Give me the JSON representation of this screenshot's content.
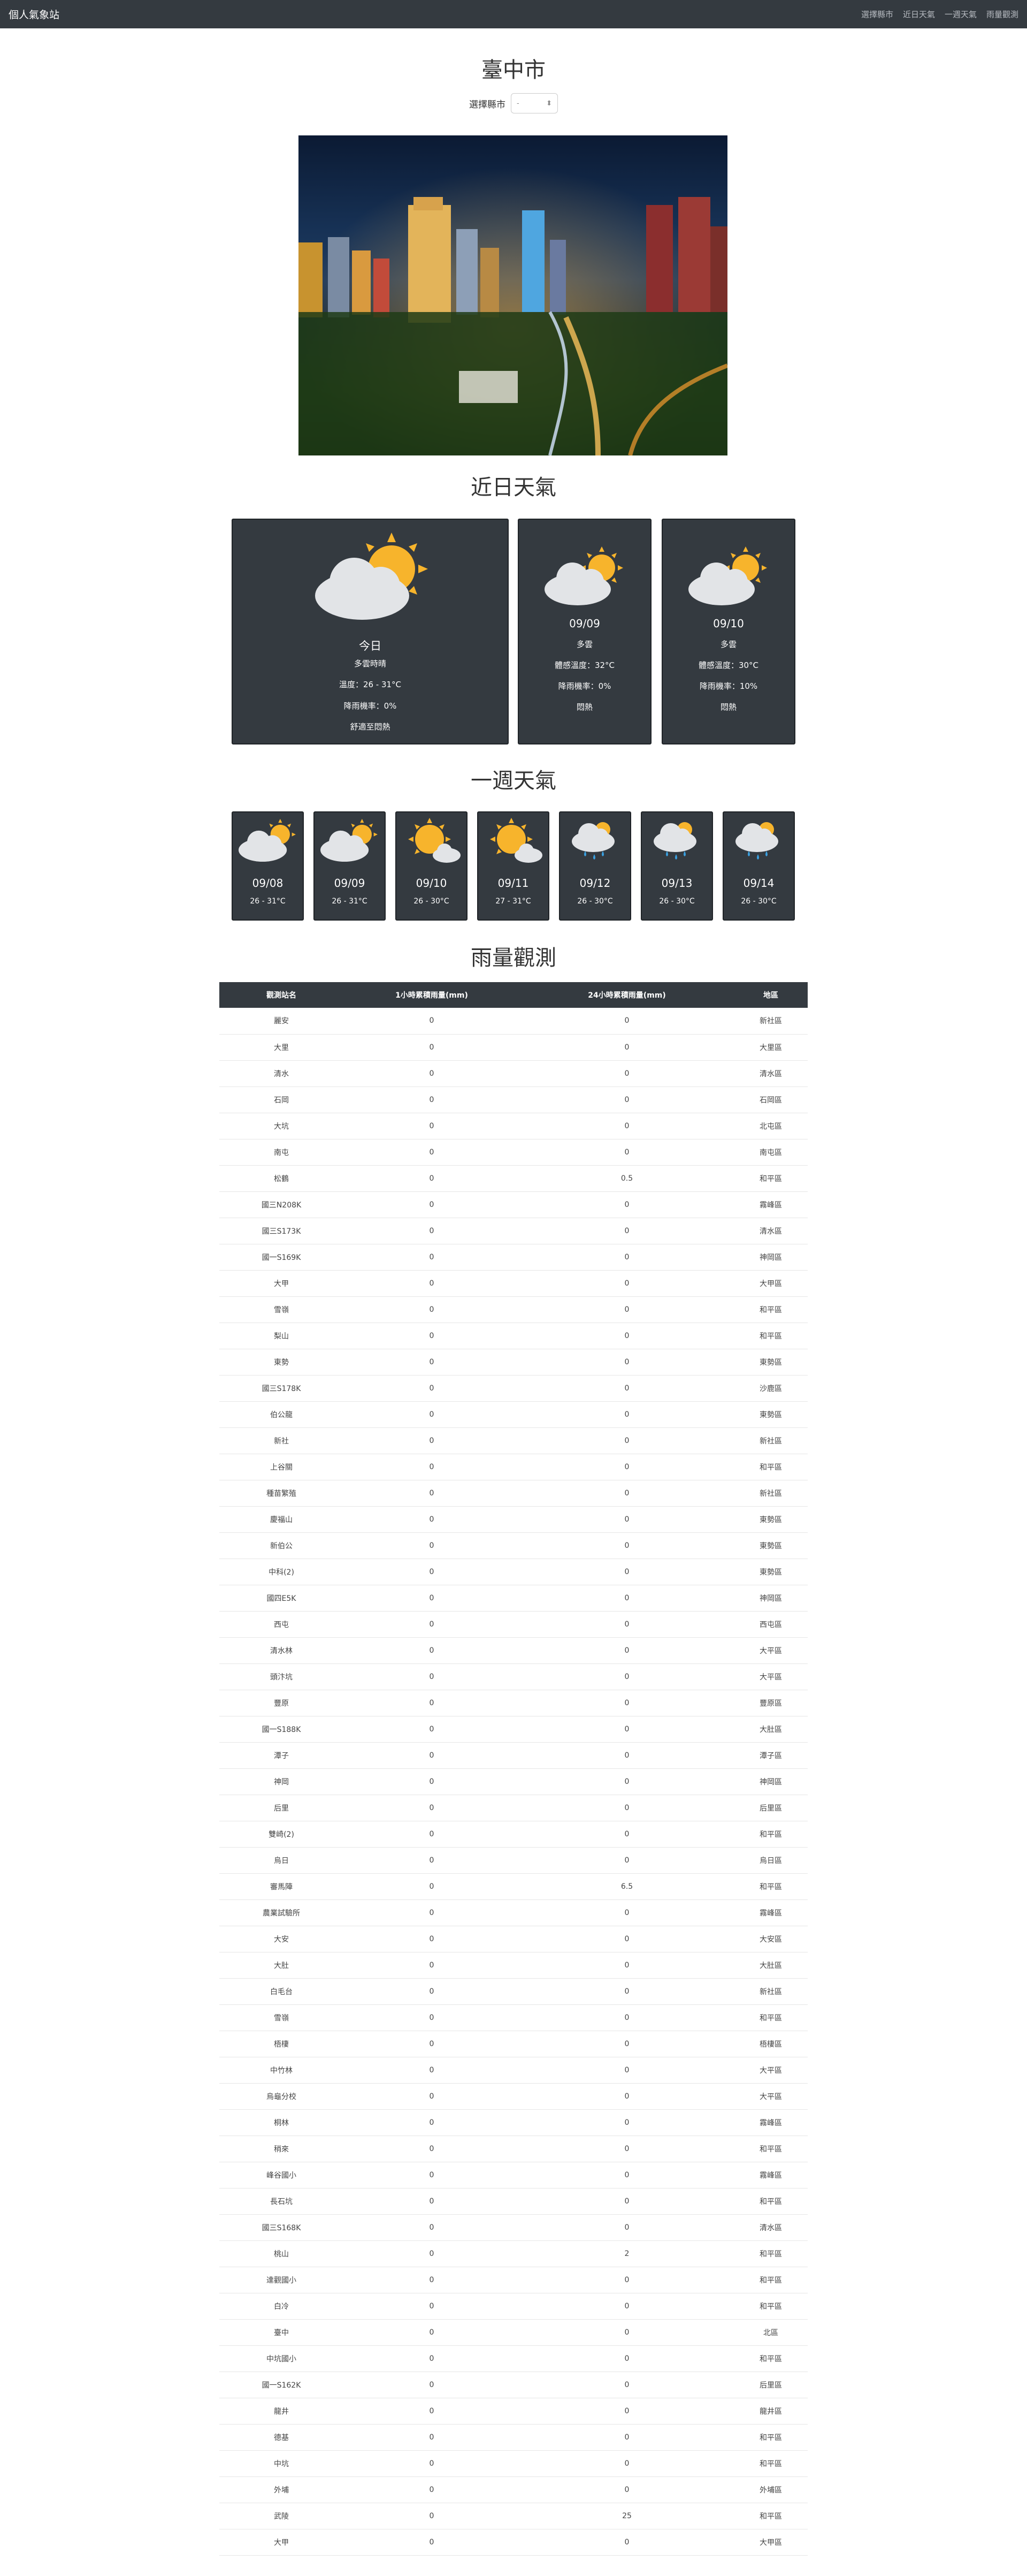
{
  "navbar": {
    "brand": "個人氣象站",
    "links": [
      "選擇縣市",
      "近日天氣",
      "一週天氣",
      "雨量觀測"
    ]
  },
  "page": {
    "city_title": "臺中市",
    "select_label": "選擇縣市",
    "select_value": "-"
  },
  "sections": {
    "recent": "近日天氣",
    "week": "一週天氣",
    "rain": "雨量觀測"
  },
  "today": {
    "label": "今日",
    "desc": "多雲時晴",
    "temp": "溫度：26 - 31°C",
    "rain": "降雨機率：0%",
    "comfort": "舒適至悶熱",
    "icon": "partly-cloudy-icon"
  },
  "next_days": [
    {
      "date": "09/09",
      "desc": "多雲",
      "temp": "體感溫度：32°C",
      "rain": "降雨機率：0%",
      "comfort": "悶熱",
      "icon": "partly-cloudy-icon"
    },
    {
      "date": "09/10",
      "desc": "多雲",
      "temp": "體感溫度：30°C",
      "rain": "降雨機率：10%",
      "comfort": "悶熱",
      "icon": "partly-cloudy-icon"
    }
  ],
  "week": [
    {
      "date": "09/08",
      "temp": "26 - 31°C",
      "icon": "partly-cloudy-icon"
    },
    {
      "date": "09/09",
      "temp": "26 - 31°C",
      "icon": "partly-cloudy-icon"
    },
    {
      "date": "09/10",
      "temp": "26 - 30°C",
      "icon": "sunny-cloud-icon"
    },
    {
      "date": "09/11",
      "temp": "27 - 31°C",
      "icon": "sunny-cloud-icon"
    },
    {
      "date": "09/12",
      "temp": "26 - 30°C",
      "icon": "rain-icon"
    },
    {
      "date": "09/13",
      "temp": "26 - 30°C",
      "icon": "rain-icon"
    },
    {
      "date": "09/14",
      "temp": "26 - 30°C",
      "icon": "rain-icon"
    }
  ],
  "rain_table": {
    "headers": [
      "觀測站名",
      "1小時累積雨量(mm)",
      "24小時累積雨量(mm)",
      "地區"
    ],
    "rows": [
      [
        "麗安",
        "0",
        "0",
        "新社區"
      ],
      [
        "大里",
        "0",
        "0",
        "大里區"
      ],
      [
        "清水",
        "0",
        "0",
        "清水區"
      ],
      [
        "石岡",
        "0",
        "0",
        "石岡區"
      ],
      [
        "大坑",
        "0",
        "0",
        "北屯區"
      ],
      [
        "南屯",
        "0",
        "0",
        "南屯區"
      ],
      [
        "松鶴",
        "0",
        "0.5",
        "和平區"
      ],
      [
        "國三N208K",
        "0",
        "0",
        "霧峰區"
      ],
      [
        "國三S173K",
        "0",
        "0",
        "清水區"
      ],
      [
        "國一S169K",
        "0",
        "0",
        "神岡區"
      ],
      [
        "大甲",
        "0",
        "0",
        "大甲區"
      ],
      [
        "雪嶺",
        "0",
        "0",
        "和平區"
      ],
      [
        "梨山",
        "0",
        "0",
        "和平區"
      ],
      [
        "東勢",
        "0",
        "0",
        "東勢區"
      ],
      [
        "國三S178K",
        "0",
        "0",
        "沙鹿區"
      ],
      [
        "伯公龍",
        "0",
        "0",
        "東勢區"
      ],
      [
        "新社",
        "0",
        "0",
        "新社區"
      ],
      [
        "上谷關",
        "0",
        "0",
        "和平區"
      ],
      [
        "種苗繁殖",
        "0",
        "0",
        "新社區"
      ],
      [
        "慶福山",
        "0",
        "0",
        "東勢區"
      ],
      [
        "新伯公",
        "0",
        "0",
        "東勢區"
      ],
      [
        "中科(2)",
        "0",
        "0",
        "東勢區"
      ],
      [
        "國四E5K",
        "0",
        "0",
        "神岡區"
      ],
      [
        "西屯",
        "0",
        "0",
        "西屯區"
      ],
      [
        "清水林",
        "0",
        "0",
        "大平區"
      ],
      [
        "頭汴坑",
        "0",
        "0",
        "大平區"
      ],
      [
        "豐原",
        "0",
        "0",
        "豐原區"
      ],
      [
        "國一S188K",
        "0",
        "0",
        "大肚區"
      ],
      [
        "潭子",
        "0",
        "0",
        "潭子區"
      ],
      [
        "神岡",
        "0",
        "0",
        "神岡區"
      ],
      [
        "后里",
        "0",
        "0",
        "后里區"
      ],
      [
        "雙崎(2)",
        "0",
        "0",
        "和平區"
      ],
      [
        "烏日",
        "0",
        "0",
        "烏日區"
      ],
      [
        "審馬陣",
        "0",
        "6.5",
        "和平區"
      ],
      [
        "農業試驗所",
        "0",
        "0",
        "霧峰區"
      ],
      [
        "大安",
        "0",
        "0",
        "大安區"
      ],
      [
        "大肚",
        "0",
        "0",
        "大肚區"
      ],
      [
        "白毛台",
        "0",
        "0",
        "新社區"
      ],
      [
        "雪嶺",
        "0",
        "0",
        "和平區"
      ],
      [
        "梧棲",
        "0",
        "0",
        "梧棲區"
      ],
      [
        "中竹林",
        "0",
        "0",
        "大平區"
      ],
      [
        "烏龜分校",
        "0",
        "0",
        "大平區"
      ],
      [
        "桐林",
        "0",
        "0",
        "霧峰區"
      ],
      [
        "稍來",
        "0",
        "0",
        "和平區"
      ],
      [
        "峰谷國小",
        "0",
        "0",
        "霧峰區"
      ],
      [
        "長石坑",
        "0",
        "0",
        "和平區"
      ],
      [
        "國三S168K",
        "0",
        "0",
        "清水區"
      ],
      [
        "桃山",
        "0",
        "2",
        "和平區"
      ],
      [
        "達觀國小",
        "0",
        "0",
        "和平區"
      ],
      [
        "白冷",
        "0",
        "0",
        "和平區"
      ],
      [
        "臺中",
        "0",
        "0",
        "北區"
      ],
      [
        "中坑國小",
        "0",
        "0",
        "和平區"
      ],
      [
        "國一S162K",
        "0",
        "0",
        "后里區"
      ],
      [
        "龍井",
        "0",
        "0",
        "龍井區"
      ],
      [
        "德基",
        "0",
        "0",
        "和平區"
      ],
      [
        "中坑",
        "0",
        "0",
        "和平區"
      ],
      [
        "外埔",
        "0",
        "0",
        "外埔區"
      ],
      [
        "武陵",
        "0",
        "25",
        "和平區"
      ],
      [
        "大甲",
        "0",
        "0",
        "大甲區"
      ]
    ]
  },
  "colors": {
    "navbar": "#343a40",
    "card": "#343a40",
    "sun": "#f7b42c",
    "cloud": "#e2e4e7",
    "raindrop": "#3aa0e0"
  }
}
